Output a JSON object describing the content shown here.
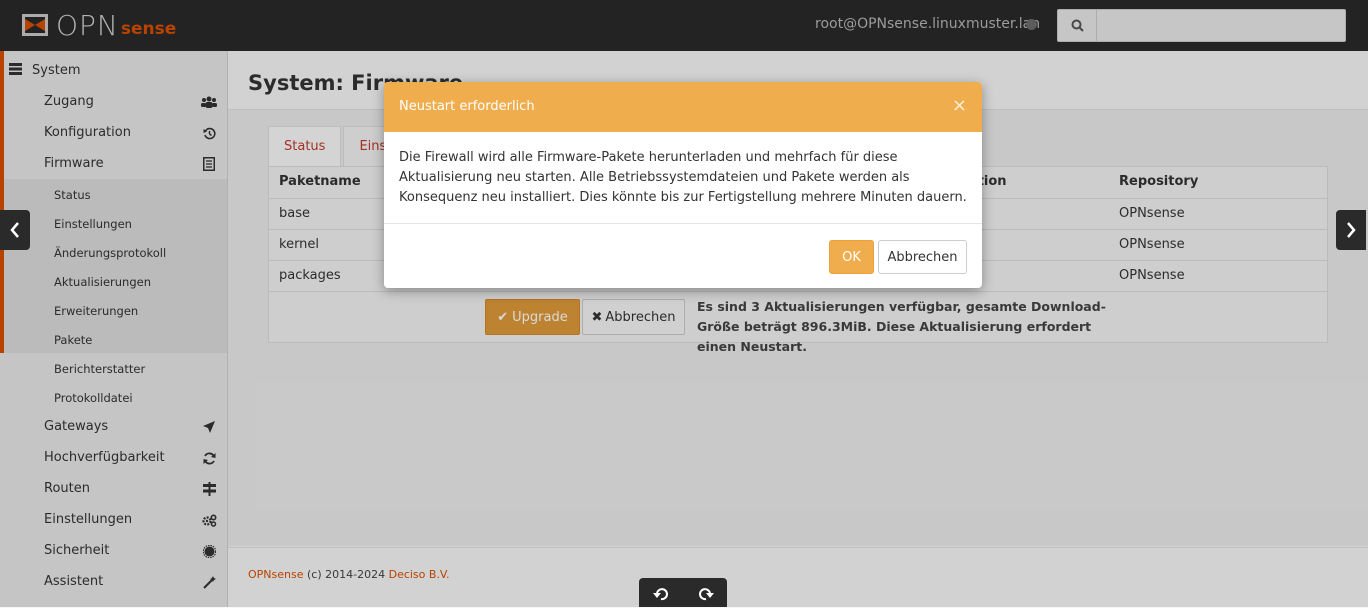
{
  "header": {
    "logo_main": "OPN",
    "logo_sub": "sense",
    "user": "root@OPNsense.linuxmuster.lan",
    "search_placeholder": ""
  },
  "sidebar": {
    "section": "System",
    "items": [
      {
        "label": "Zugang",
        "icon": "users-icon"
      },
      {
        "label": "Konfiguration",
        "icon": "history-icon"
      },
      {
        "label": "Firmware",
        "icon": "list-icon"
      },
      {
        "label": "Status"
      },
      {
        "label": "Einstellungen"
      },
      {
        "label": "Änderungsprotokoll"
      },
      {
        "label": "Aktualisierungen"
      },
      {
        "label": "Erweiterungen"
      },
      {
        "label": "Pakete"
      },
      {
        "label": "Berichterstatter"
      },
      {
        "label": "Protokolldatei"
      },
      {
        "label": "Gateways",
        "icon": "location-arrow-icon"
      },
      {
        "label": "Hochverfügbarkeit",
        "icon": "refresh-icon"
      },
      {
        "label": "Routen",
        "icon": "signpost-icon"
      },
      {
        "label": "Einstellungen",
        "icon": "cogs-icon"
      },
      {
        "label": "Sicherheit",
        "icon": "certificate-icon"
      },
      {
        "label": "Assistent",
        "icon": "magic-icon"
      }
    ]
  },
  "page": {
    "title": "System: Firmware",
    "tabs": [
      "Status",
      "Einstellungen"
    ],
    "table": {
      "headers": [
        "Paketname",
        "Aktion",
        "Repository"
      ],
      "rows": [
        [
          "base",
          "OPNsense"
        ],
        [
          "kernel",
          "OPNsense"
        ],
        [
          "packages",
          "OPNsense"
        ]
      ]
    },
    "upgrade_button": "Upgrade",
    "abort_button": "Abbrechen",
    "upgrade_note": "Es sind 3 Aktualisierungen verfügbar, gesamte Download-Größe beträgt 896.3MiB. Diese Aktualisierung erfordert einen Neustart."
  },
  "footer": {
    "brand": "OPNsense",
    "copyright": "(c) 2014-2024",
    "company": "Deciso B.V."
  },
  "modal": {
    "title": "Neustart erforderlich",
    "close": "×",
    "body": "Die Firewall wird alle Firmware-Pakete herunterladen und mehrfach für diese Aktualisierung neu starten. Alle Betriebssystemdateien und Pakete werden als Konsequenz neu installiert. Dies könnte bis zur Fertigstellung mehrere Minuten dauern.",
    "ok": "OK",
    "cancel": "Abbrechen"
  },
  "colors": {
    "accent": "#d94f00",
    "warning": "#f0ad4e",
    "topbar": "#2a2a2a"
  }
}
